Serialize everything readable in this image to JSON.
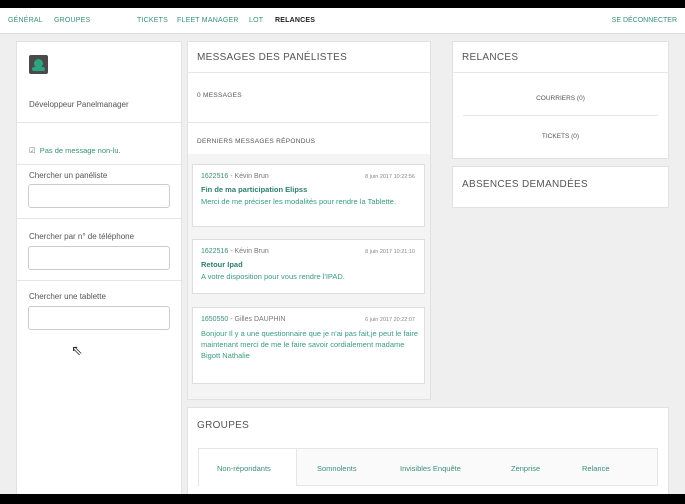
{
  "nav": {
    "items": [
      "GÉNÉRAL",
      "GROUPES",
      "TICKETS",
      "FLEET MANAGER",
      "LOT",
      "RELANCES"
    ],
    "active": "RELANCES",
    "logout": "SE DÉCONNECTER"
  },
  "sidebar": {
    "avatar_icon": "robot-avatar-icon",
    "user_name": "Développeur Panelmanager",
    "unread_check": "☑",
    "unread": "Pas de message non-lu.",
    "search_panelist_label": "Chercher un panéliste",
    "search_panelist_value": "",
    "search_phone_label": "Chercher par n° de téléphone",
    "search_phone_value": "",
    "search_tablet_label": "Chercher une tablette",
    "search_tablet_value": ""
  },
  "messages": {
    "title": "MESSAGES DES PANÉLISTES",
    "count_label": "0 MESSAGES",
    "last_replies_label": "DERNIERS MESSAGES RÉPONDUS",
    "cards": [
      {
        "id": "1622516",
        "name": "Kévin Brun",
        "date": "8 juin 2017 10:22:56",
        "subject": "Fin de ma participation Elipss",
        "body": "Merci de me préciser les modalités pour rendre la Tablette."
      },
      {
        "id": "1622516",
        "name": "Kévin Brun",
        "date": "8 juin 2017 10:21:10",
        "subject": "Retour Ipad",
        "body": "A votre disposition pour vous rendre l'IPAD."
      },
      {
        "id": "1650550",
        "name": "Gilles DAUPHIN",
        "date": "6 juin 2017 20:22:07",
        "subject": "",
        "body": "Bonjour Il y a une questionnaire que je n'ai pas fait,je peut le faire maintenant merci de me le faire savoir cordialement madame Bigott Nathalie"
      }
    ]
  },
  "relances": {
    "title": "RELANCES",
    "courriers": "COURRIERS (0)",
    "tickets": "TICKETS (0)"
  },
  "absences": {
    "title": "ABSENCES DEMANDÉES"
  },
  "groupes": {
    "title": "GROUPES",
    "tabs": [
      "Non-répondants",
      "Somnolents",
      "Invisibles Enquête",
      "Zenprise",
      "Relance"
    ]
  },
  "colors": {
    "accent": "#3a8f77",
    "panel_bg": "#ffffff",
    "page_bg": "#efefef"
  }
}
